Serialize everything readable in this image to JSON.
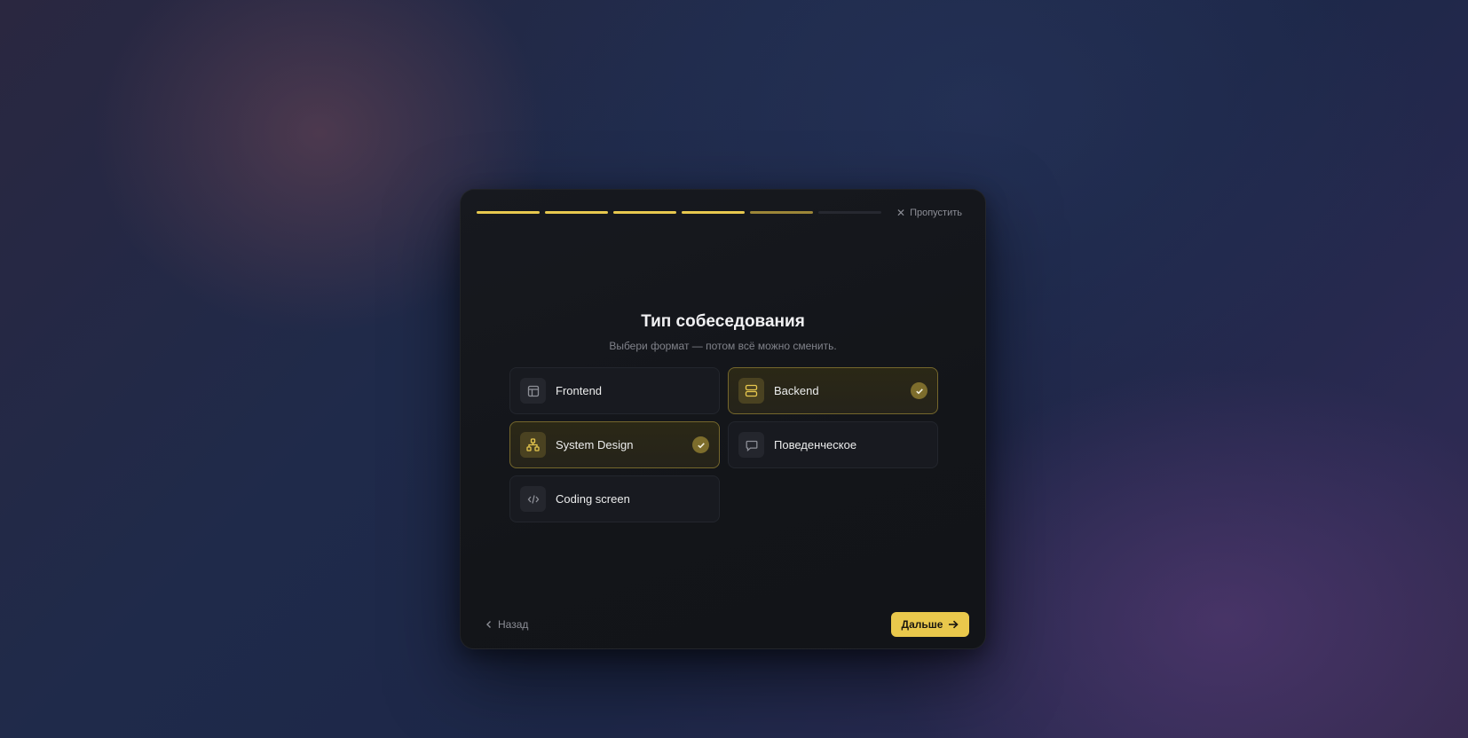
{
  "wizard": {
    "steps": [
      {
        "state": "done"
      },
      {
        "state": "done"
      },
      {
        "state": "done"
      },
      {
        "state": "done"
      },
      {
        "state": "current"
      },
      {
        "state": "pending"
      }
    ],
    "skip_label": "Пропустить",
    "title": "Тип собеседования",
    "subtitle": "Выбери формат — потом всё можно сменить.",
    "options": [
      {
        "label": "Frontend",
        "icon": "layout-icon",
        "selected": false
      },
      {
        "label": "Backend",
        "icon": "server-icon",
        "selected": true
      },
      {
        "label": "System Design",
        "icon": "hierarchy-icon",
        "selected": true
      },
      {
        "label": "Поведенческое",
        "icon": "chat-bubble-icon",
        "selected": false
      },
      {
        "label": "Coding screen",
        "icon": "code-icon",
        "selected": false
      }
    ],
    "back_label": "Назад",
    "next_label": "Дальше"
  },
  "colors": {
    "accent": "#e9c84c",
    "accent_dim": "#9c8638",
    "card_bg": "#181a20",
    "modal_bg": "#15171c"
  }
}
